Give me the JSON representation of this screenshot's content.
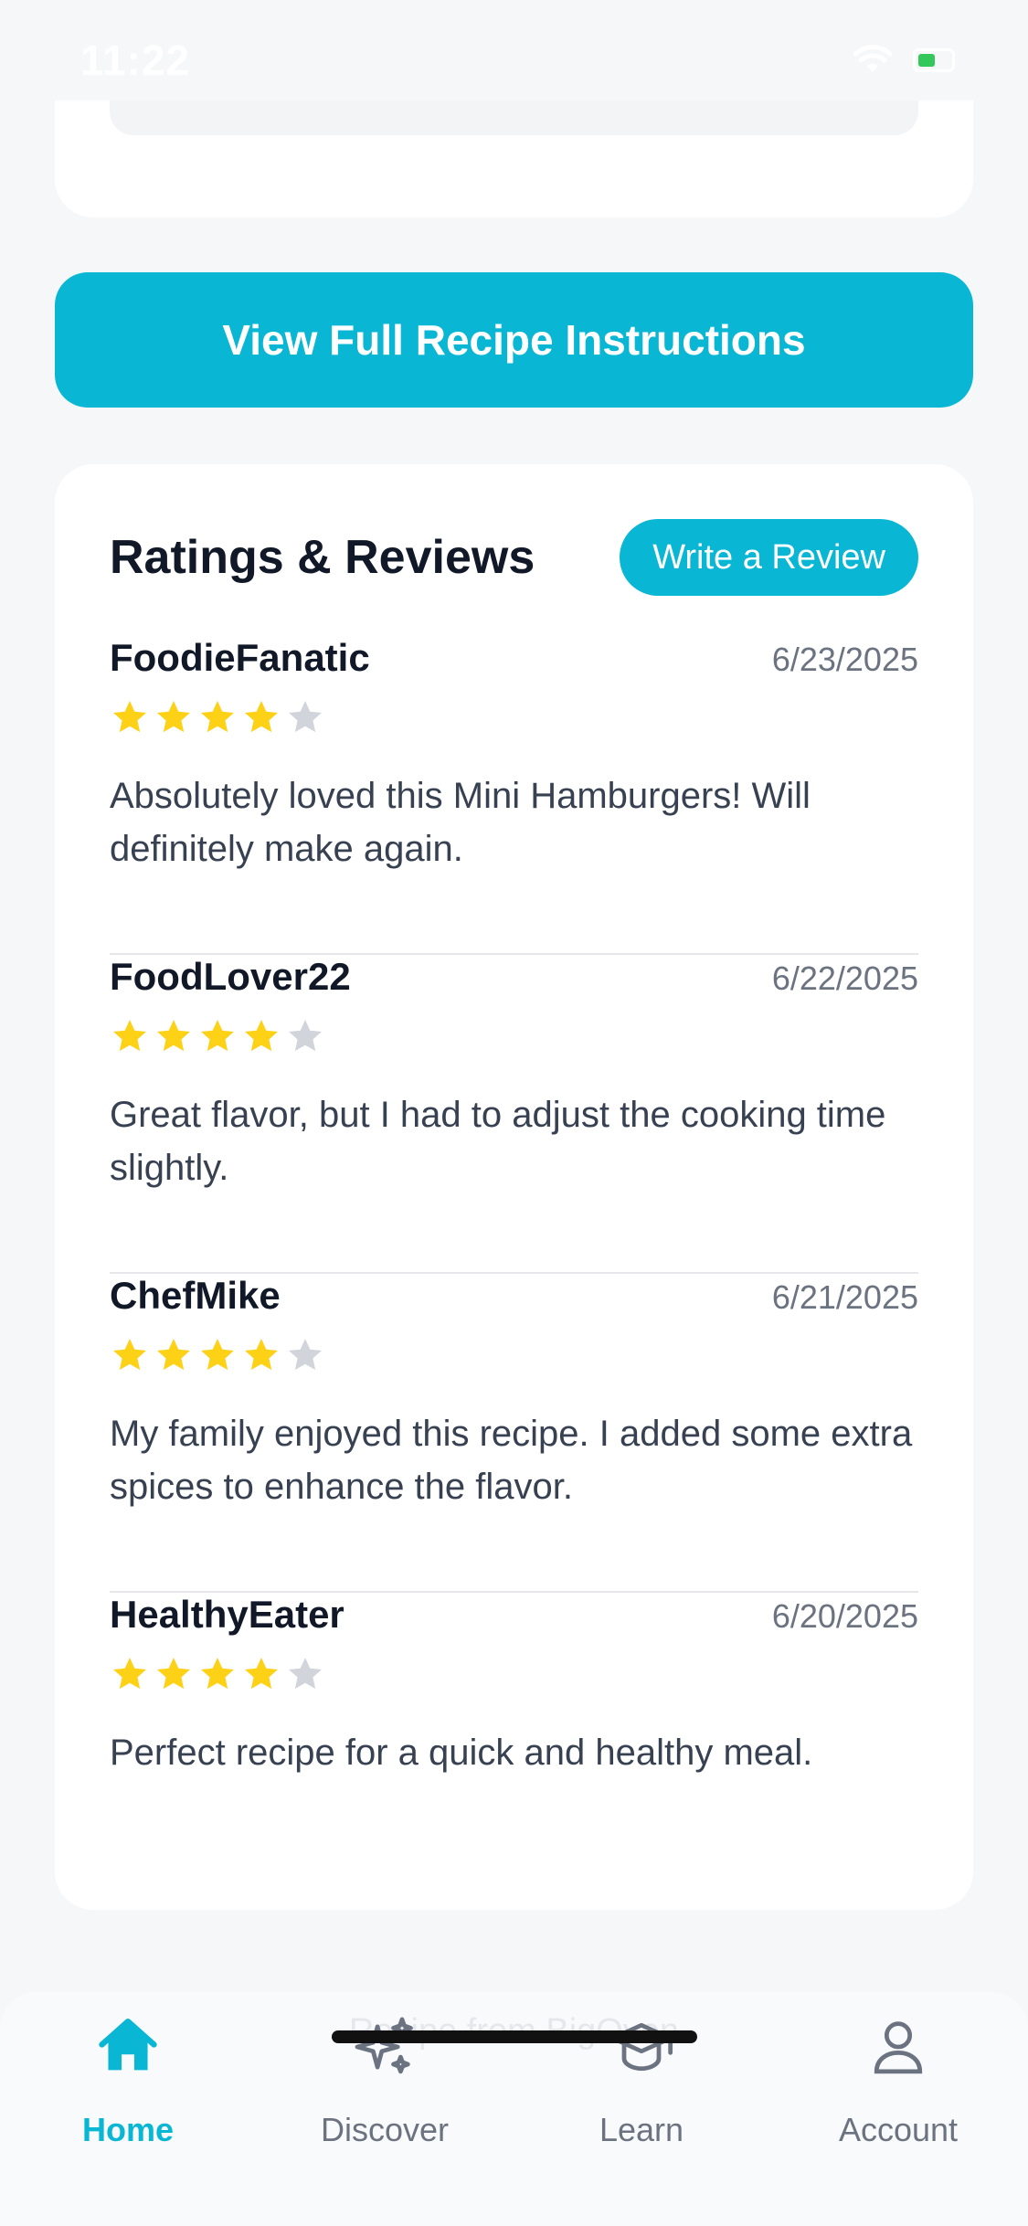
{
  "status_bar": {
    "time": "11:22"
  },
  "main": {
    "view_recipe_button": "View Full Recipe Instructions",
    "reviews": {
      "title": "Ratings & Reviews",
      "write_review_label": "Write a Review",
      "items": [
        {
          "author": "FoodieFanatic",
          "date": "6/23/2025",
          "rating": 4,
          "max_rating": 5,
          "text": "Absolutely loved this Mini Hamburgers! Will definitely make again."
        },
        {
          "author": "FoodLover22",
          "date": "6/22/2025",
          "rating": 4,
          "max_rating": 5,
          "text": "Great flavor, but I had to adjust the cooking time slightly."
        },
        {
          "author": "ChefMike",
          "date": "6/21/2025",
          "rating": 4,
          "max_rating": 5,
          "text": "My family enjoyed this recipe. I added some extra spices to enhance the flavor."
        },
        {
          "author": "HealthyEater",
          "date": "6/20/2025",
          "rating": 4,
          "max_rating": 5,
          "text": "Perfect recipe for a quick and healthy meal."
        }
      ]
    }
  },
  "footer_ghost_text": "Recipe from BigOven",
  "bottom_nav": {
    "items": [
      {
        "label": "Home",
        "icon": "home-icon",
        "active": true
      },
      {
        "label": "Discover",
        "icon": "sparkles-icon",
        "active": false
      },
      {
        "label": "Learn",
        "icon": "graduation-cap-icon",
        "active": false
      },
      {
        "label": "Account",
        "icon": "user-icon",
        "active": false
      }
    ]
  },
  "colors": {
    "accent": "#09b6d4",
    "star_filled": "#fcd116",
    "star_empty": "#d1d5db",
    "nav_inactive": "#6b7280"
  }
}
